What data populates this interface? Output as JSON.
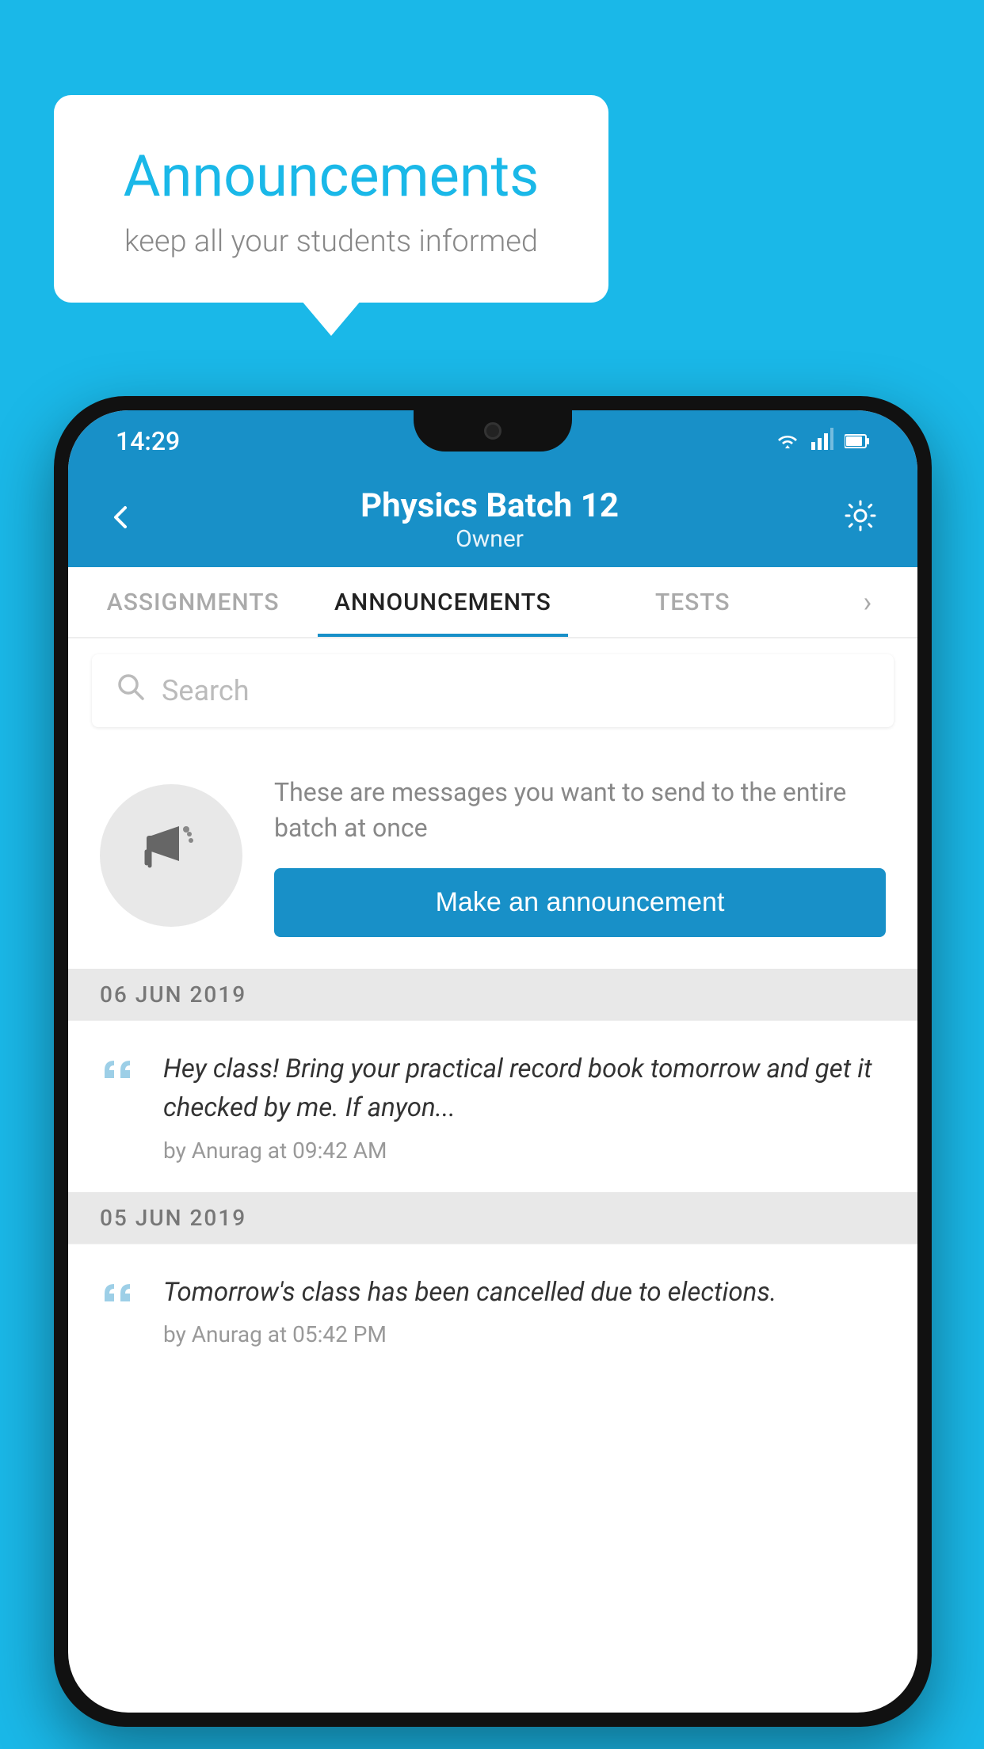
{
  "background_color": "#1ab8e8",
  "speech_bubble": {
    "title": "Announcements",
    "subtitle": "keep all your students informed"
  },
  "phone": {
    "status_bar": {
      "time": "14:29",
      "icons": [
        "wifi",
        "signal",
        "battery"
      ]
    },
    "header": {
      "title": "Physics Batch 12",
      "subtitle": "Owner"
    },
    "tabs": [
      {
        "label": "ASSIGNMENTS",
        "active": false
      },
      {
        "label": "ANNOUNCEMENTS",
        "active": true
      },
      {
        "label": "TESTS",
        "active": false
      }
    ],
    "search": {
      "placeholder": "Search"
    },
    "promo": {
      "description": "These are messages you want to send to the entire batch at once",
      "button_label": "Make an announcement"
    },
    "announcements": [
      {
        "date": "06  JUN  2019",
        "text": "Hey class! Bring your practical record book tomorrow and get it checked by me. If anyon...",
        "meta": "by Anurag at 09:42 AM"
      },
      {
        "date": "05  JUN  2019",
        "text": "Tomorrow's class has been cancelled due to elections.",
        "meta": "by Anurag at 05:42 PM"
      }
    ]
  }
}
